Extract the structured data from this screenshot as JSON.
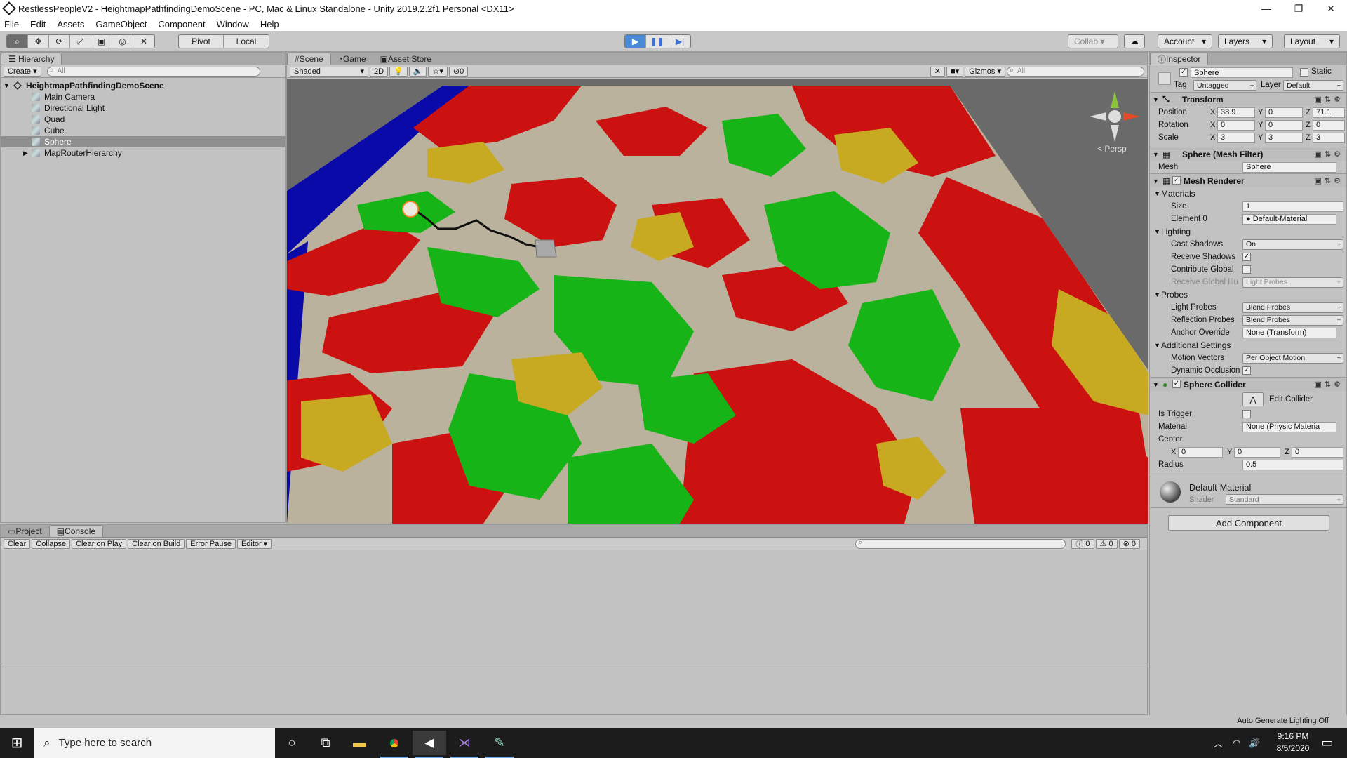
{
  "window": {
    "title": "RestlessPeopleV2 - HeightmapPathfindingDemoScene - PC, Mac & Linux Standalone - Unity 2019.2.2f1 Personal <DX11>",
    "min": "—",
    "max": "❐",
    "close": "✕"
  },
  "menu": [
    "File",
    "Edit",
    "Assets",
    "GameObject",
    "Component",
    "Window",
    "Help"
  ],
  "toolbar": {
    "pivot": "Pivot",
    "local": "Local",
    "collab": "Collab ▾",
    "account": "Account",
    "layers": "Layers",
    "layout": "Layout"
  },
  "hierarchy": {
    "tab": "Hierarchy",
    "create": "Create ▾",
    "search_placeholder": "All",
    "scene_name": "HeightmapPathfindingDemoScene",
    "items": [
      "Main Camera",
      "Directional Light",
      "Quad",
      "Cube",
      "Sphere",
      "MapRouterHierarchy"
    ],
    "selected": "Sphere"
  },
  "scene": {
    "tabs": [
      "Scene",
      "Game",
      "Asset Store"
    ],
    "shading": "Shaded",
    "mode_2d": "2D",
    "fx_count": "0",
    "gizmos": "Gizmos",
    "search_placeholder": "All",
    "persp": "< Persp",
    "colors": {
      "red": "#cc1111",
      "green": "#16b416",
      "yellow": "#c8aa22",
      "beige": "#bab29c",
      "blue": "#0a0aa8"
    }
  },
  "inspector": {
    "tab": "Inspector",
    "object_name": "Sphere",
    "static_label": "Static",
    "tag_label": "Tag",
    "tag_value": "Untagged",
    "layer_label": "Layer",
    "layer_value": "Default",
    "transform": {
      "title": "Transform",
      "position": {
        "label": "Position",
        "x": "38.9",
        "y": "0",
        "z": "71.1"
      },
      "rotation": {
        "label": "Rotation",
        "x": "0",
        "y": "0",
        "z": "0"
      },
      "scale": {
        "label": "Scale",
        "x": "3",
        "y": "3",
        "z": "3"
      }
    },
    "mesh_filter": {
      "title": "Sphere (Mesh Filter)",
      "mesh_label": "Mesh",
      "mesh_value": "Sphere"
    },
    "mesh_renderer": {
      "title": "Mesh Renderer",
      "materials": "Materials",
      "size_label": "Size",
      "size_value": "1",
      "element0_label": "Element 0",
      "element0_value": "Default-Material",
      "lighting": "Lighting",
      "cast_shadows_label": "Cast Shadows",
      "cast_shadows_value": "On",
      "receive_shadows_label": "Receive Shadows",
      "contribute_gi_label": "Contribute Global",
      "receive_gi_label": "Receive Global Illu",
      "receive_gi_value": "Light Probes",
      "probes": "Probes",
      "light_probes_label": "Light Probes",
      "light_probes_value": "Blend Probes",
      "reflection_probes_label": "Reflection Probes",
      "reflection_probes_value": "Blend Probes",
      "anchor_label": "Anchor Override",
      "anchor_value": "None (Transform)",
      "additional": "Additional Settings",
      "motion_label": "Motion Vectors",
      "motion_value": "Per Object Motion",
      "dynamic_occ_label": "Dynamic Occlusion"
    },
    "sphere_collider": {
      "title": "Sphere Collider",
      "edit_collider": "Edit Collider",
      "is_trigger_label": "Is Trigger",
      "material_label": "Material",
      "material_value": "None (Physic Materia",
      "center_label": "Center",
      "cx": "0",
      "cy": "0",
      "cz": "0",
      "radius_label": "Radius",
      "radius_value": "0.5"
    },
    "material": {
      "name": "Default-Material",
      "shader_label": "Shader",
      "shader_value": "Standard"
    },
    "add_component": "Add Component"
  },
  "console": {
    "tabs": [
      "Project",
      "Console"
    ],
    "buttons": [
      "Clear",
      "Collapse",
      "Clear on Play",
      "Clear on Build",
      "Error Pause"
    ],
    "editor": "Editor ▾",
    "counts": {
      "info": "0",
      "warn": "0",
      "error": "0"
    }
  },
  "status": {
    "auto_lighting": "Auto Generate Lighting Off"
  },
  "taskbar": {
    "search_placeholder": "Type here to search",
    "time": "9:16 PM",
    "date": "8/5/2020"
  }
}
